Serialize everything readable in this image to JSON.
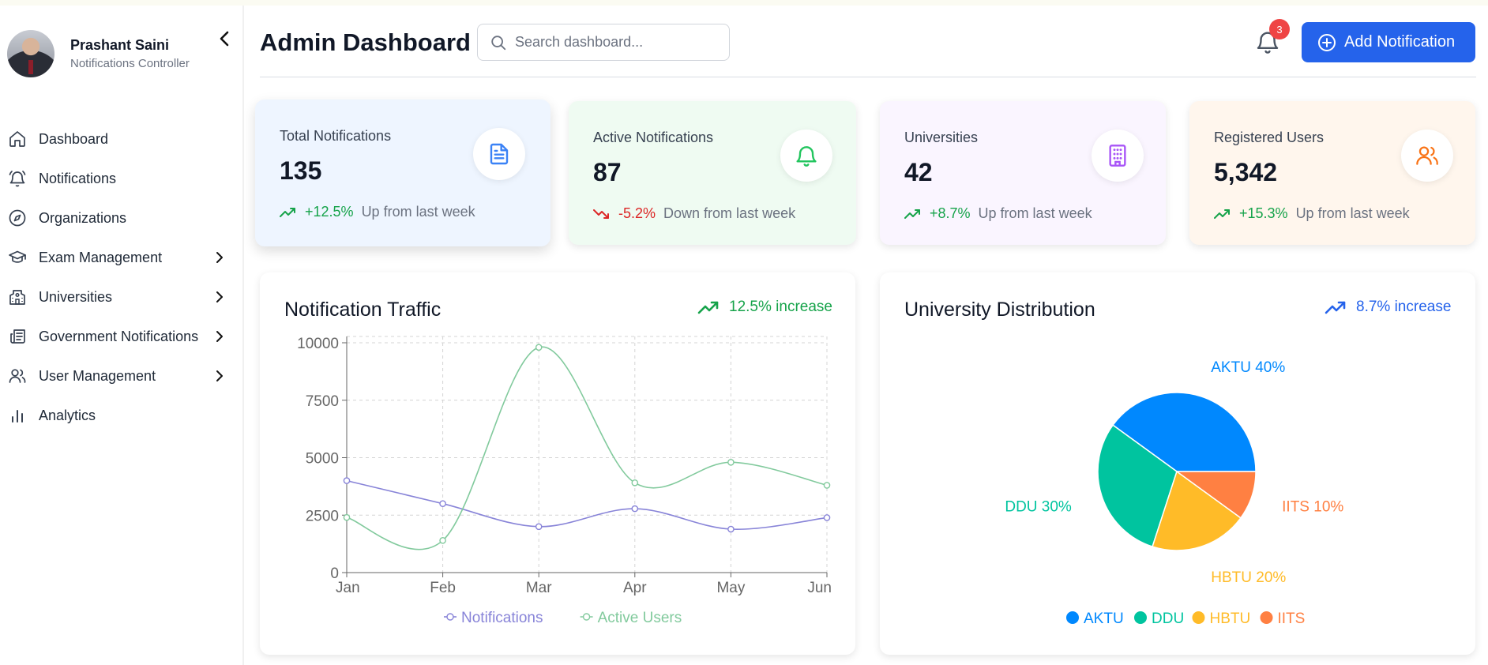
{
  "profile": {
    "name": "Prashant Saini",
    "role": "Notifications Controller"
  },
  "sidebar": {
    "items": [
      {
        "label": "Dashboard",
        "icon": "home-icon",
        "has_children": false
      },
      {
        "label": "Notifications",
        "icon": "bell-ring-icon",
        "has_children": false
      },
      {
        "label": "Organizations",
        "icon": "compass-icon",
        "has_children": false
      },
      {
        "label": "Exam Management",
        "icon": "graduation-cap-icon",
        "has_children": true
      },
      {
        "label": "Universities",
        "icon": "school-icon",
        "has_children": true
      },
      {
        "label": "Government Notifications",
        "icon": "newspaper-icon",
        "has_children": true
      },
      {
        "label": "User Management",
        "icon": "users-icon",
        "has_children": true
      },
      {
        "label": "Analytics",
        "icon": "bar-chart-icon",
        "has_children": false
      }
    ]
  },
  "header": {
    "title": "Admin Dashboard",
    "search_placeholder": "Search dashboard...",
    "notification_count": "3",
    "add_button_label": "Add Notification"
  },
  "stats": [
    {
      "title": "Total Notifications",
      "value": "135",
      "trend": "+12.5%",
      "trend_dir": "up",
      "note": "Up from last week",
      "icon": "file-text-icon",
      "bg": "#eef5ff",
      "icon_color": "#3b82f6"
    },
    {
      "title": "Active Notifications",
      "value": "87",
      "trend": "-5.2%",
      "trend_dir": "down",
      "note": "Down from last week",
      "icon": "bell-icon",
      "bg": "#effbf2",
      "icon_color": "#22c55e"
    },
    {
      "title": "Universities",
      "value": "42",
      "trend": "+8.7%",
      "trend_dir": "up",
      "note": "Up from last week",
      "icon": "building-icon",
      "bg": "#faf5ff",
      "icon_color": "#a855f7"
    },
    {
      "title": "Registered Users",
      "value": "5,342",
      "trend": "+15.3%",
      "trend_dir": "up",
      "note": "Up from last week",
      "icon": "users-icon",
      "bg": "#fff6ed",
      "icon_color": "#f97316"
    }
  ],
  "traffic": {
    "title": "Notification Traffic",
    "increase": "12.5% increase",
    "increase_color": "#16a34a"
  },
  "distribution": {
    "title": "University Distribution",
    "increase": "8.7% increase",
    "increase_color": "#2563eb"
  },
  "chart_data": [
    {
      "type": "line",
      "title": "Notification Traffic",
      "x": [
        "Jan",
        "Feb",
        "Mar",
        "Apr",
        "May",
        "Jun"
      ],
      "ylim": [
        0,
        10000
      ],
      "yticks": [
        0,
        2500,
        5000,
        7500,
        10000
      ],
      "grid": true,
      "legend_position": "bottom",
      "series": [
        {
          "name": "Notifications",
          "color": "#8884d8",
          "values": [
            4000,
            3000,
            2000,
            2780,
            1890,
            2390
          ]
        },
        {
          "name": "Active Users",
          "color": "#82ca9d",
          "values": [
            2400,
            1398,
            9800,
            3908,
            4800,
            3800
          ]
        }
      ]
    },
    {
      "type": "pie",
      "title": "University Distribution",
      "legend_position": "bottom",
      "slices": [
        {
          "name": "AKTU",
          "value": 40,
          "color": "#0088fe",
          "label": "AKTU 40%"
        },
        {
          "name": "DDU",
          "value": 30,
          "color": "#00c49f",
          "label": "DDU 30%"
        },
        {
          "name": "HBTU",
          "value": 20,
          "color": "#ffbb28",
          "label": "HBTU 20%"
        },
        {
          "name": "IITS",
          "value": 10,
          "color": "#ff8042",
          "label": "IITS 10%"
        }
      ]
    }
  ]
}
